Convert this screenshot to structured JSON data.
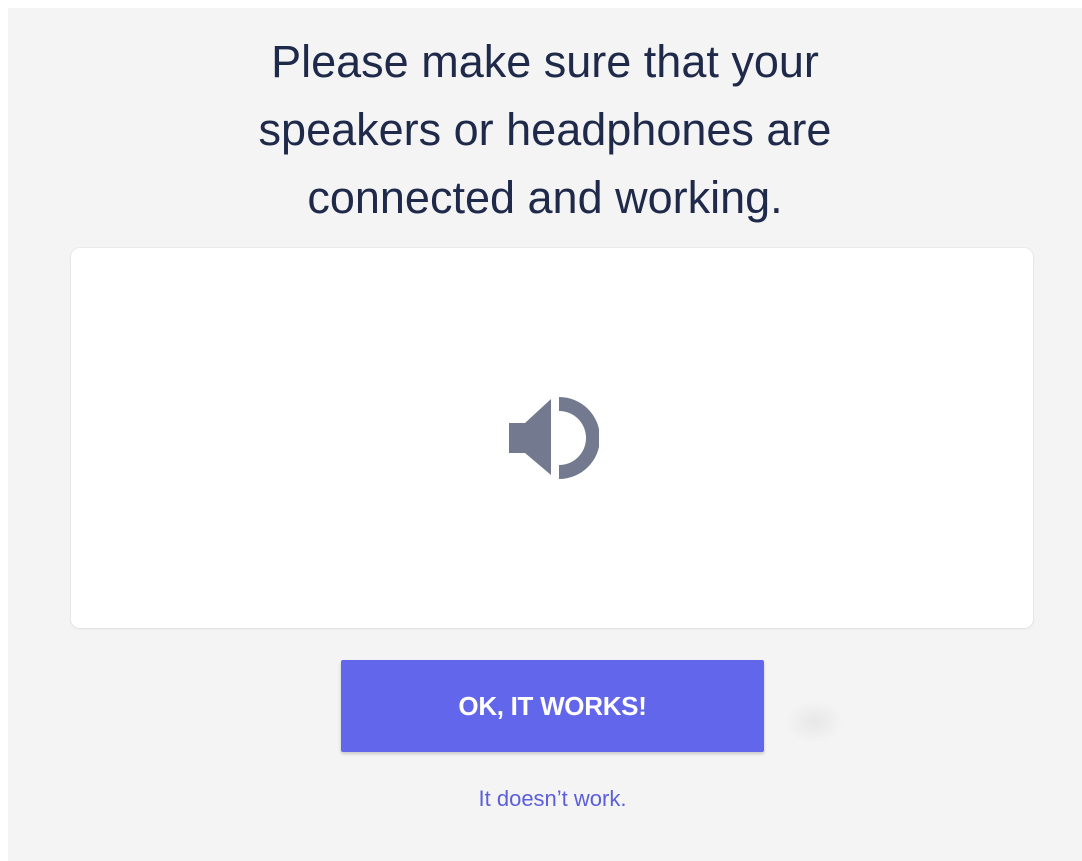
{
  "prompt": {
    "lines": [
      "Please make sure that your",
      "speakers or headphones are",
      "connected and working."
    ]
  },
  "sound_test": {
    "icon": "speaker-volume-icon",
    "icon_color": "#737a8f"
  },
  "actions": {
    "ok_label": "OK, IT WORKS!",
    "fail_label": "It doesn’t work."
  },
  "colors": {
    "background": "#f4f4f4",
    "heading": "#1f2a4a",
    "primary": "#6266ea",
    "link": "#5b5fd9"
  }
}
